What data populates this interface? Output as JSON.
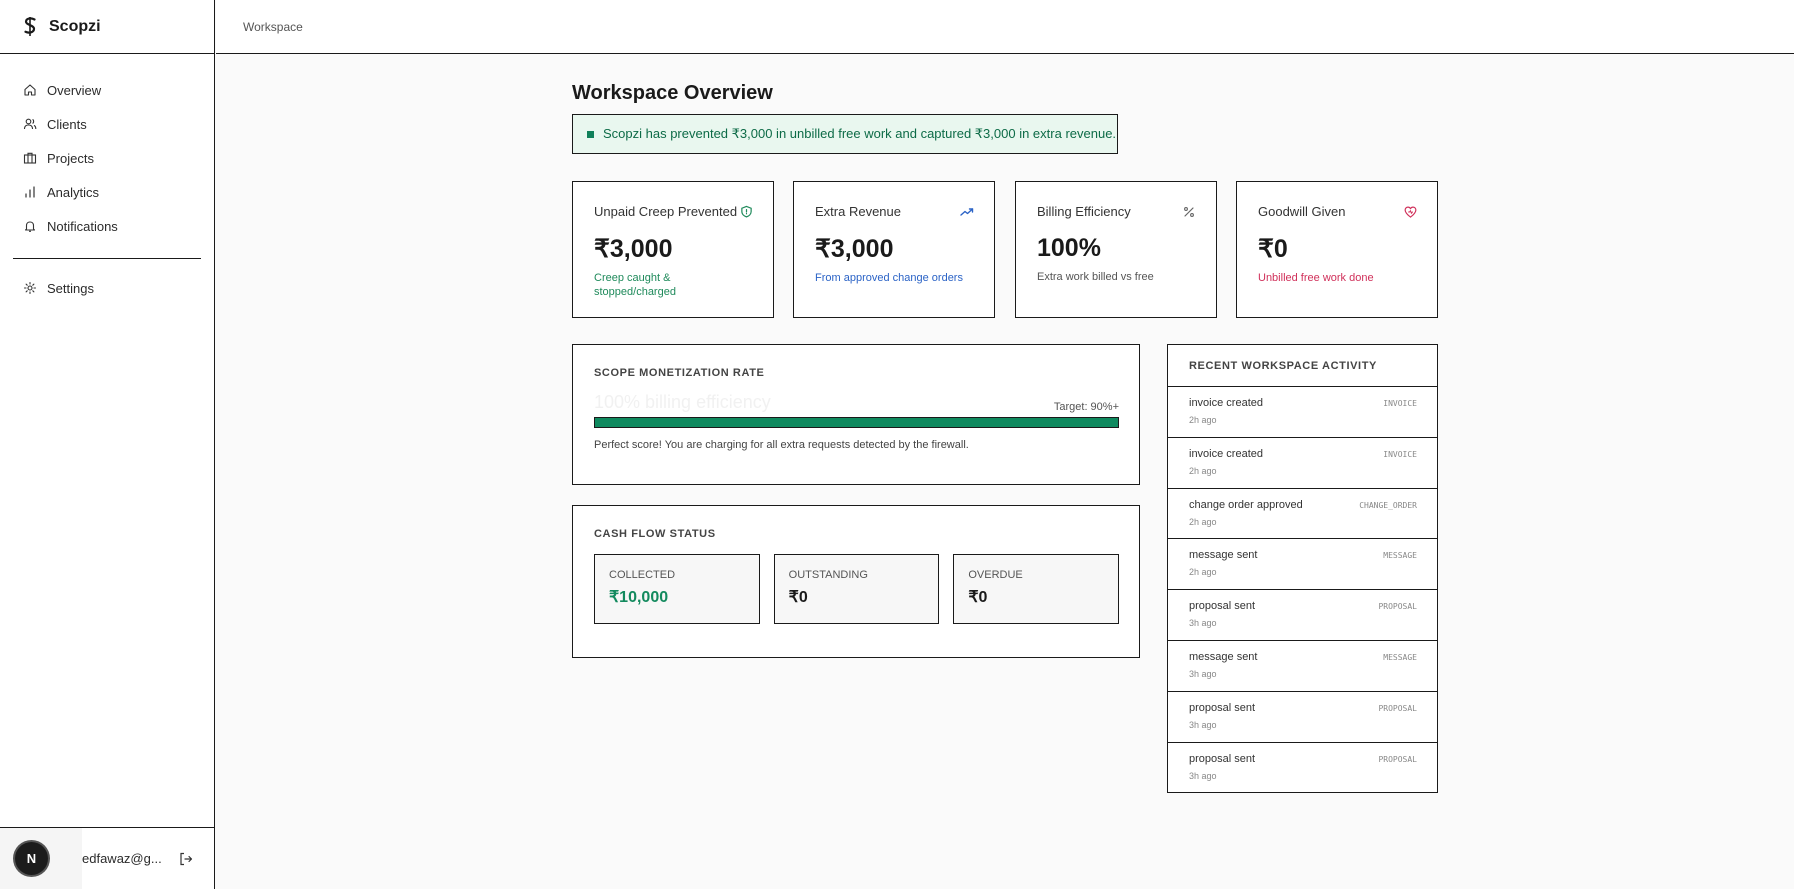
{
  "app": {
    "name": "Scopzi"
  },
  "breadcrumb": "Workspace",
  "sidebar": {
    "items": [
      {
        "label": "Overview",
        "icon": "home-icon"
      },
      {
        "label": "Clients",
        "icon": "users-icon"
      },
      {
        "label": "Projects",
        "icon": "briefcase-icon"
      },
      {
        "label": "Analytics",
        "icon": "bar-chart-icon"
      },
      {
        "label": "Notifications",
        "icon": "bell-icon"
      }
    ],
    "settings": {
      "label": "Settings",
      "icon": "gear-icon"
    },
    "user": {
      "avatar_letter": "N",
      "email": "edfawaz@g..."
    }
  },
  "page": {
    "title": "Workspace Overview",
    "banner": "Scopzi has prevented ₹3,000 in unbilled free work and captured ₹3,000 in extra revenue."
  },
  "stats": [
    {
      "label": "Unpaid Creep Prevented",
      "value": "₹3,000",
      "sub": "Creep caught & stopped/charged",
      "icon": "shield-icon",
      "color": "#1f8a5b"
    },
    {
      "label": "Extra Revenue",
      "value": "₹3,000",
      "sub": "From approved change orders",
      "icon": "trending-up-icon",
      "color": "#2b63c6"
    },
    {
      "label": "Billing Efficiency",
      "value": "100%",
      "sub": "Extra work billed vs free",
      "icon": "percent-icon",
      "color": "#555555"
    },
    {
      "label": "Goodwill Given",
      "value": "₹0",
      "sub": "Unbilled free work done",
      "icon": "heart-icon",
      "color": "#d0305a"
    }
  ],
  "monetization": {
    "title": "SCOPE MONETIZATION RATE",
    "ghost_text": "100% billing efficiency",
    "target": "Target: 90%+",
    "progress": 100,
    "note": "Perfect score! You are charging for all extra requests detected by the firewall."
  },
  "cashflow": {
    "title": "CASH FLOW STATUS",
    "cards": [
      {
        "label": "COLLECTED",
        "value": "₹10,000",
        "color": "#138a5e"
      },
      {
        "label": "OUTSTANDING",
        "value": "₹0",
        "color": "#1a1a1a"
      },
      {
        "label": "OVERDUE",
        "value": "₹0",
        "color": "#1a1a1a"
      }
    ]
  },
  "activity": {
    "title": "RECENT WORKSPACE ACTIVITY",
    "items": [
      {
        "title": "invoice created",
        "tag": "INVOICE",
        "time": "2h ago"
      },
      {
        "title": "invoice created",
        "tag": "INVOICE",
        "time": "2h ago"
      },
      {
        "title": "change order approved",
        "tag": "CHANGE_ORDER",
        "time": "2h ago"
      },
      {
        "title": "message sent",
        "tag": "MESSAGE",
        "time": "2h ago"
      },
      {
        "title": "proposal sent",
        "tag": "PROPOSAL",
        "time": "3h ago"
      },
      {
        "title": "message sent",
        "tag": "MESSAGE",
        "time": "3h ago"
      },
      {
        "title": "proposal sent",
        "tag": "PROPOSAL",
        "time": "3h ago"
      },
      {
        "title": "proposal sent",
        "tag": "PROPOSAL",
        "time": "3h ago"
      }
    ]
  }
}
